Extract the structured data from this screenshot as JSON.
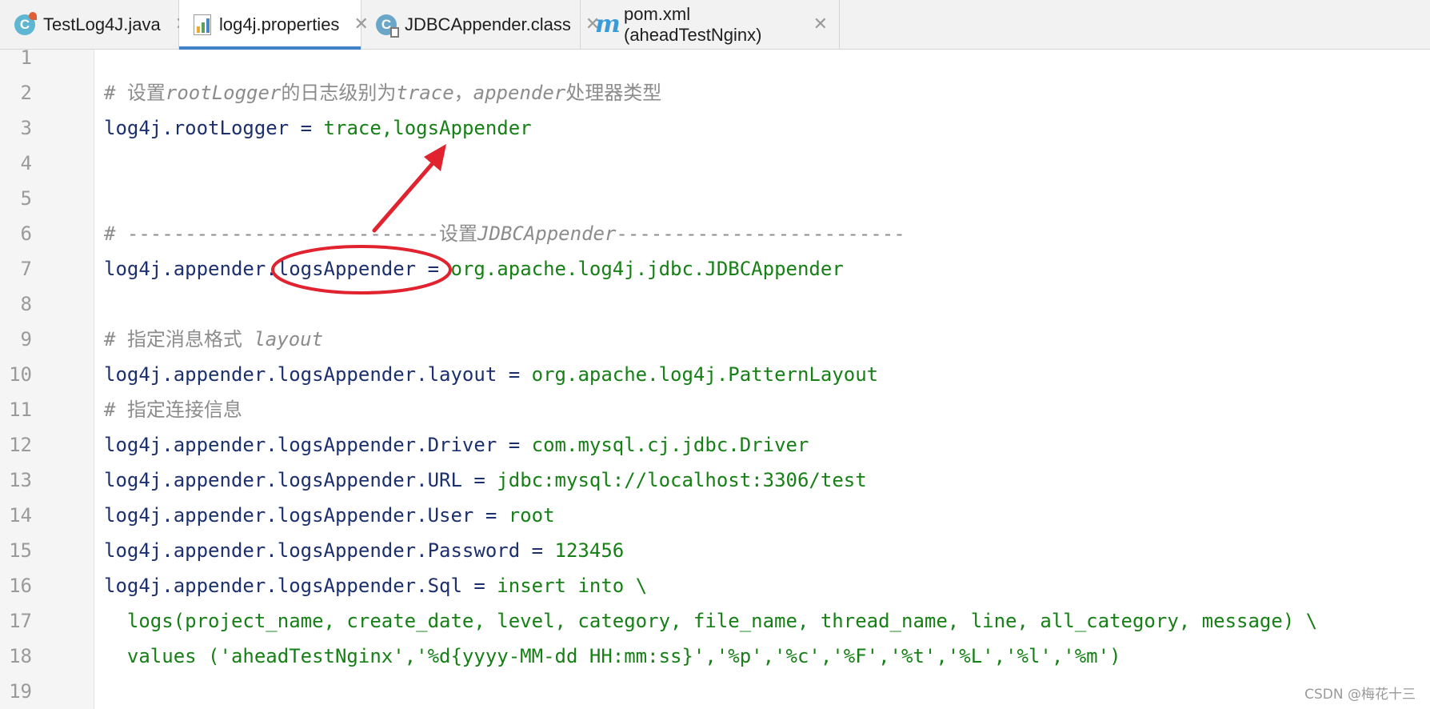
{
  "tabs": [
    {
      "label": "TestLog4J.java",
      "icon": "java-class-icon"
    },
    {
      "label": "log4j.properties",
      "icon": "properties-file-icon"
    },
    {
      "label": "JDBCAppender.class",
      "icon": "class-file-icon"
    },
    {
      "label": "pom.xml (aheadTestNginx)",
      "icon": "maven-icon"
    }
  ],
  "active_tab": "log4j.properties",
  "editor": {
    "line_numbers": [
      "1",
      "2",
      "3",
      "4",
      "5",
      "6",
      "7",
      "8",
      "9",
      "10",
      "11",
      "12",
      "13",
      "14",
      "15",
      "16",
      "17",
      "18",
      "19"
    ],
    "lines": [
      {
        "n": 2,
        "comment": [
          "# 设置",
          "rootLogger",
          "的日志级别为",
          "trace",
          "，",
          "appender",
          "处理器类型"
        ]
      },
      {
        "n": 3,
        "key": "log4j.rootLogger",
        "sep": " = ",
        "val": "trace,logsAppender"
      },
      {
        "n": 6,
        "comment": [
          "# ---------------------------设置",
          "JDBCAppender",
          "-------------------------"
        ]
      },
      {
        "n": 7,
        "key": "log4j.appender.logsAppender",
        "sep": " = ",
        "val": "org.apache.log4j.jdbc.JDBCAppender"
      },
      {
        "n": 9,
        "comment": [
          "# 指定消息格式 ",
          "layout"
        ]
      },
      {
        "n": 10,
        "key": "log4j.appender.logsAppender.layout",
        "sep": " = ",
        "val": "org.apache.log4j.PatternLayout"
      },
      {
        "n": 11,
        "comment": [
          "# 指定连接信息"
        ]
      },
      {
        "n": 12,
        "key": "log4j.appender.logsAppender.Driver",
        "sep": " = ",
        "val": "com.mysql.cj.jdbc.Driver"
      },
      {
        "n": 13,
        "key": "log4j.appender.logsAppender.URL",
        "sep": " = ",
        "val": "jdbc:mysql://localhost:3306/test"
      },
      {
        "n": 14,
        "key": "log4j.appender.logsAppender.User",
        "sep": " = ",
        "val": "root"
      },
      {
        "n": 15,
        "key": "log4j.appender.logsAppender.Password",
        "sep": " = ",
        "val": "123456"
      },
      {
        "n": 16,
        "key": "log4j.appender.logsAppender.Sql",
        "sep": " = ",
        "val": "insert into \\"
      },
      {
        "n": 17,
        "val": "  logs(project_name, create_date, level, category, file_name, thread_name, line, all_category, message) \\"
      },
      {
        "n": 18,
        "val": "  values ('aheadTestNginx','%d{yyyy-MM-dd HH:mm:ss}','%p','%c','%F','%t','%L','%l','%m')"
      }
    ]
  },
  "watermark": "CSDN @梅花十三",
  "colors": {
    "key": "#1c2f6e",
    "value": "#168016",
    "comment": "#8c8c8c",
    "annotation": "#e0232e",
    "active_tab_underline": "#4083c9"
  }
}
